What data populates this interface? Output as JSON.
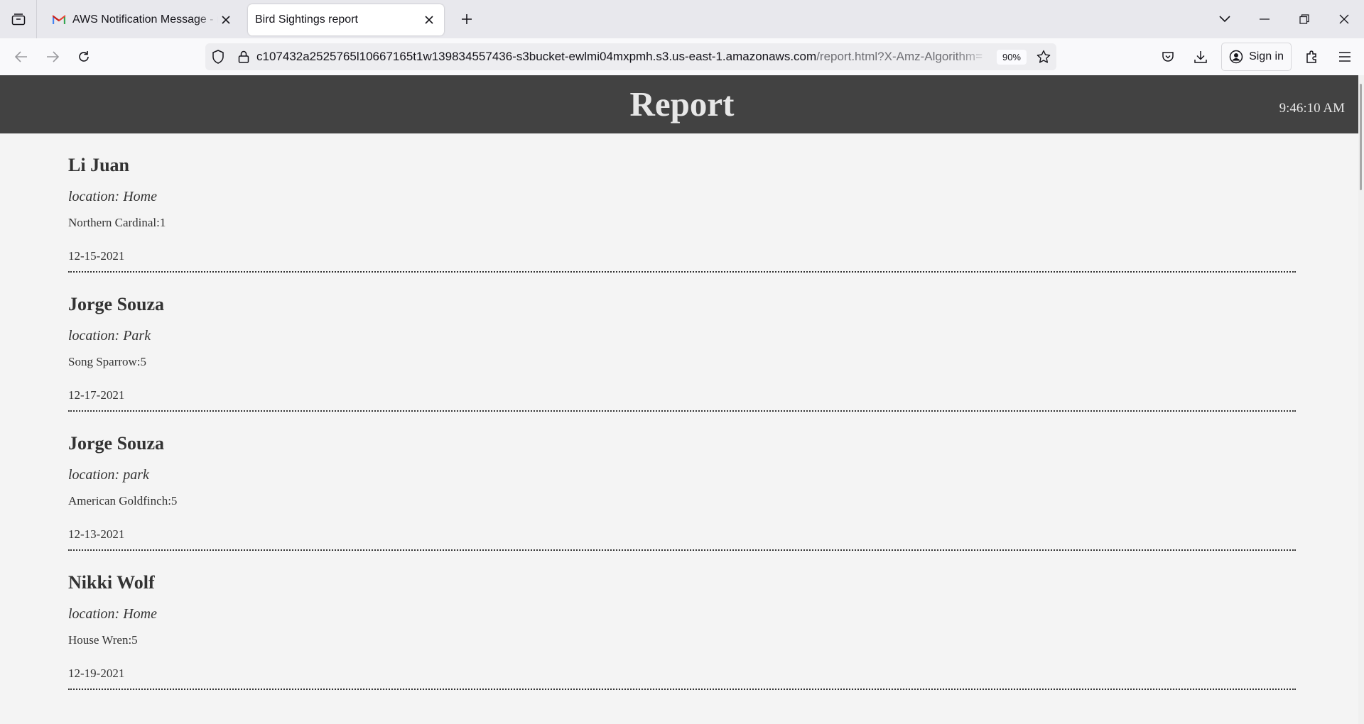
{
  "browser": {
    "tabs": [
      {
        "label": "AWS Notification Message - m3",
        "active": false,
        "favicon": "gmail-icon"
      },
      {
        "label": "Bird Sightings report",
        "active": true,
        "favicon": "none"
      }
    ],
    "url_host": "c107432a2525765l10667165t1w139834557436-s3bucket-ewlmi04mxpmh.s3.us-east-1.amazonaws.com",
    "url_path": "/report.html?X-Amz-Algorithm=",
    "zoom": "90%",
    "signin_label": "Sign in"
  },
  "report": {
    "title": "Report",
    "time": "9:46:10 AM",
    "entries": [
      {
        "name": "Li Juan",
        "location": "location: Home",
        "sighting": "Northern Cardinal:1",
        "date": "12-15-2021"
      },
      {
        "name": "Jorge Souza",
        "location": "location: Park",
        "sighting": "Song Sparrow:5",
        "date": "12-17-2021"
      },
      {
        "name": "Jorge Souza",
        "location": "location: park",
        "sighting": "American Goldfinch:5",
        "date": "12-13-2021"
      },
      {
        "name": "Nikki Wolf",
        "location": "location: Home",
        "sighting": "House Wren:5",
        "date": "12-19-2021"
      }
    ]
  }
}
